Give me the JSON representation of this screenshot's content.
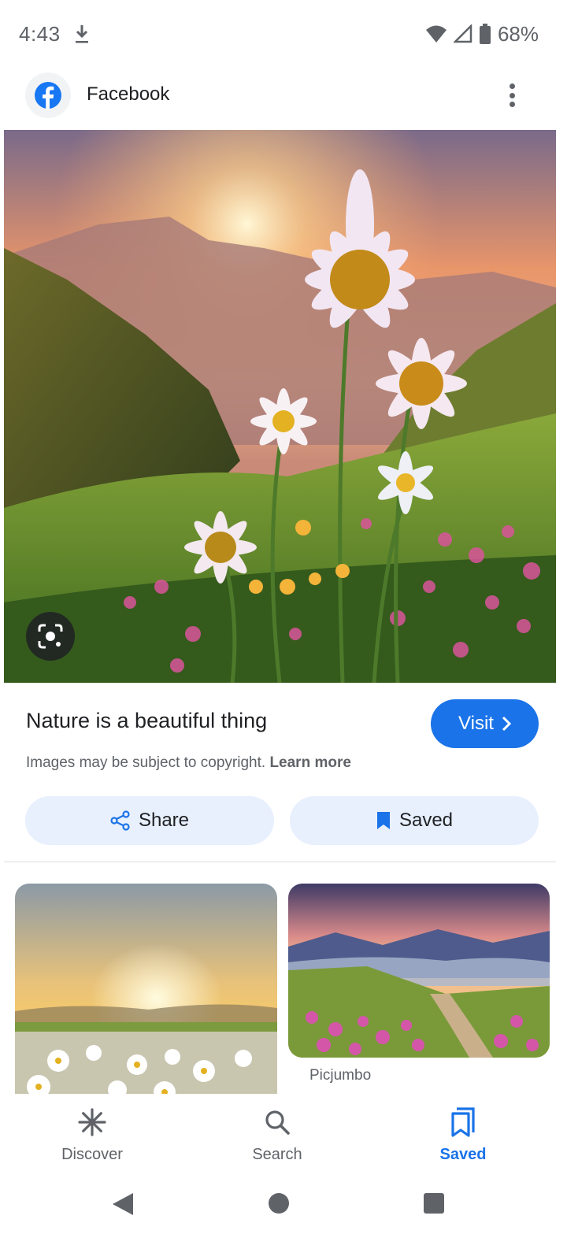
{
  "status_bar": {
    "time": "4:43",
    "battery_text": "68%",
    "icons": [
      "download-icon",
      "wifi-icon",
      "signal-icon",
      "battery-icon"
    ]
  },
  "source": {
    "name": "Facebook",
    "icon": "facebook-logo-icon",
    "brand_color": "#1877f2"
  },
  "result": {
    "title": "Nature is a beautiful thing",
    "visit_label": "Visit",
    "copyright_text": "Images may be subject to copyright.",
    "learn_more": "Learn more"
  },
  "actions": {
    "share_label": "Share",
    "saved_label": "Saved"
  },
  "related": {
    "item2_source": "Picjumbo"
  },
  "bottom_nav": {
    "items": [
      {
        "label": "Discover",
        "icon": "discover-asterisk-icon"
      },
      {
        "label": "Search",
        "icon": "search-icon"
      },
      {
        "label": "Saved",
        "icon": "saved-bookmarks-icon",
        "active": true
      }
    ]
  },
  "colors": {
    "accent": "#1a73e8",
    "pill_bg": "#e8f0fe",
    "text_secondary": "#5f6368"
  }
}
